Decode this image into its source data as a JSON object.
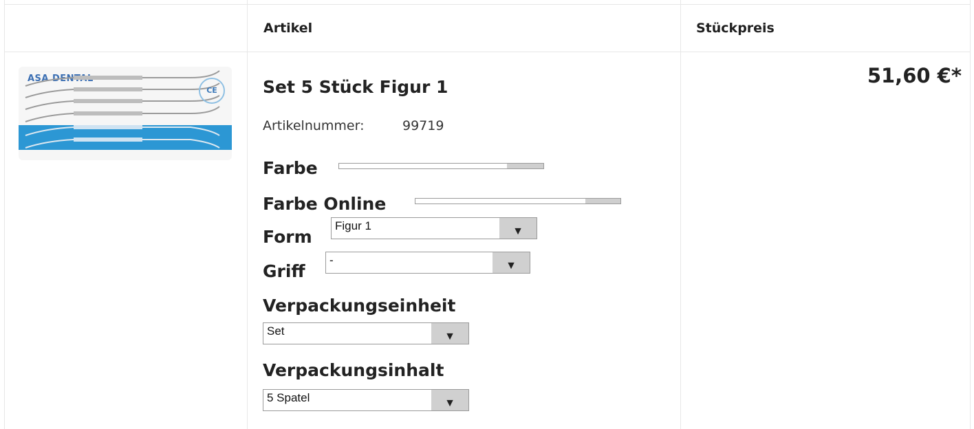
{
  "table": {
    "headers": {
      "article": "Artikel",
      "unit_price": "Stückpreis"
    }
  },
  "product": {
    "image": {
      "brand_text": "ASA DENTAL",
      "ce_mark": "CE"
    },
    "title": "Set 5 Stück Figur 1",
    "article_number_label": "Artikelnummer:",
    "article_number": "99719",
    "price": "51,60 €*"
  },
  "options": {
    "farbe": {
      "label": "Farbe",
      "fill_fraction": 0.82
    },
    "farbe_online": {
      "label": "Farbe Online",
      "fill_fraction": 0.83
    },
    "form": {
      "label": "Form",
      "selected": "Figur 1"
    },
    "griff": {
      "label": "Griff",
      "selected": "-"
    },
    "verpackungseinheit": {
      "label": "Verpackungseinheit",
      "selected": "Set"
    },
    "verpackungsinhalt": {
      "label": "Verpackungsinhalt",
      "selected": "5 Spatel"
    }
  },
  "icons": {
    "dropdown": "triangle-down-icon"
  }
}
